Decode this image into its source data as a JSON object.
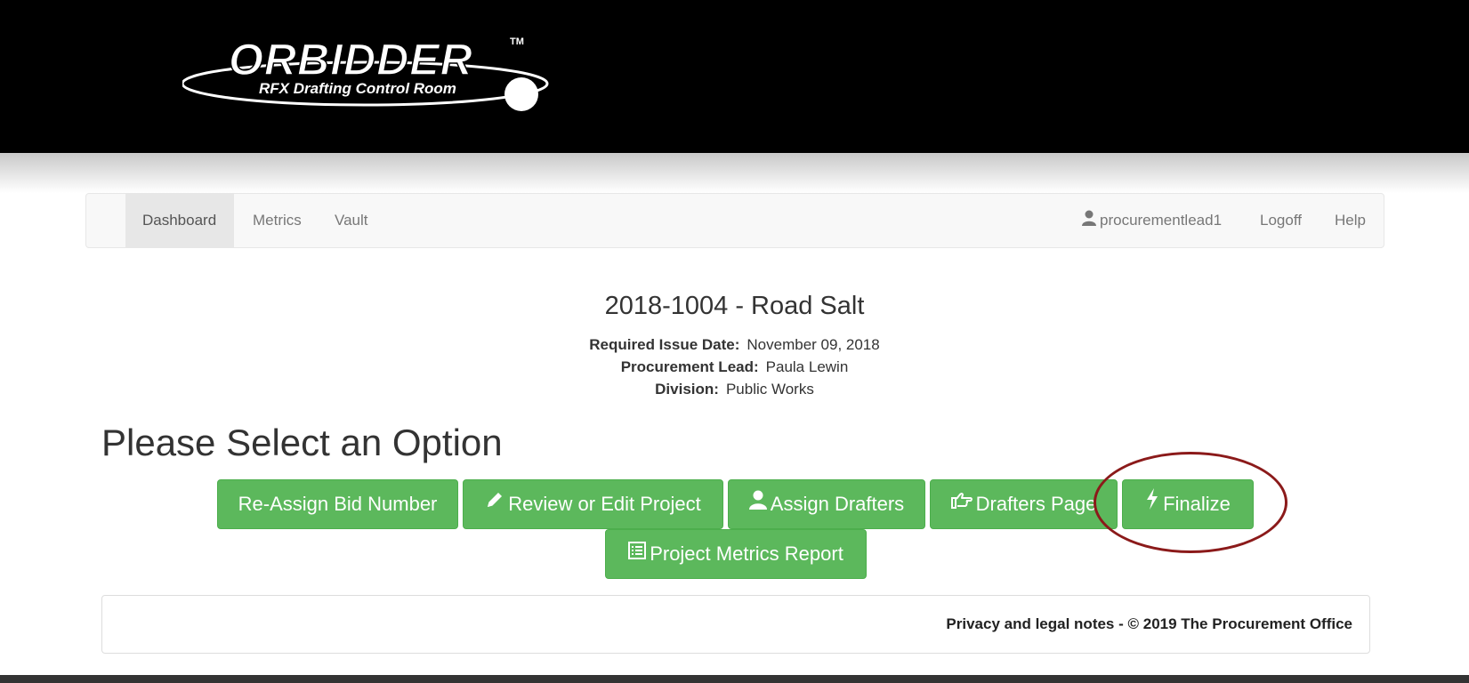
{
  "brand": {
    "logo_text": "ORBIDDER",
    "logo_tm": "TM",
    "tagline": "RFX Drafting Control Room"
  },
  "nav": {
    "items": [
      {
        "label": "Dashboard",
        "active": true
      },
      {
        "label": "Metrics",
        "active": false
      },
      {
        "label": "Vault",
        "active": false
      }
    ],
    "user": {
      "label": "procurementlead1",
      "icon": "user-icon"
    },
    "logoff_label": "Logoff",
    "help_label": "Help"
  },
  "project": {
    "title": "2018-1004 - Road Salt",
    "issue_date_label": "Required Issue Date:",
    "issue_date": "November 09, 2018",
    "lead_label": "Procurement Lead:",
    "lead": "Paula Lewin",
    "division_label": "Division:",
    "division": "Public Works"
  },
  "options": {
    "heading": "Please Select an Option",
    "buttons": [
      {
        "label": "Re-Assign Bid Number",
        "icon": ""
      },
      {
        "label": "Review or Edit Project",
        "icon": "pencil-icon"
      },
      {
        "label": "Assign Drafters",
        "icon": "user-icon"
      },
      {
        "label": "Drafters Page",
        "icon": "hand-pointing-icon"
      },
      {
        "label": "Finalize",
        "icon": "lightning-icon"
      },
      {
        "label": "Project Metrics Report",
        "icon": "list-icon"
      }
    ]
  },
  "footer": {
    "text": "Privacy and legal notes - © 2019 The Procurement Office"
  },
  "colors": {
    "button_green": "#5cb85c",
    "highlight_circle": "#8b1a1a",
    "banner": "#000000"
  }
}
